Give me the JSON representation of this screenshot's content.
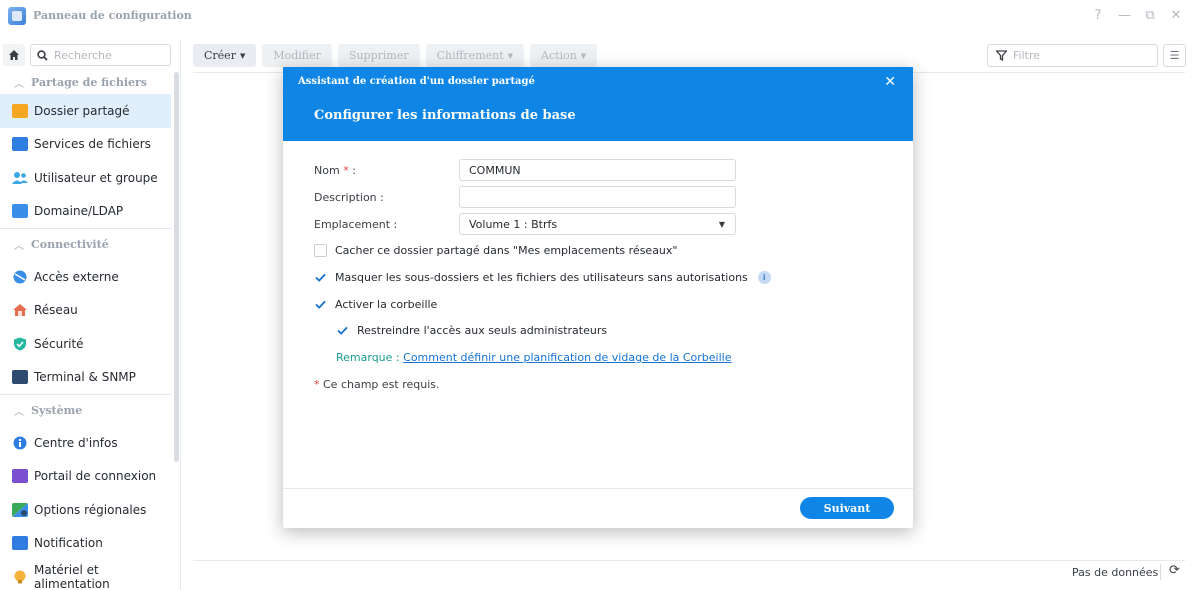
{
  "window": {
    "title": "Panneau de configuration",
    "controls": {
      "help": "?",
      "minimize": "—",
      "maximize": "⧉",
      "close": "✕"
    }
  },
  "sidebar": {
    "search_placeholder": "Recherche",
    "sections": [
      {
        "title": "Partage de fichiers",
        "items": [
          {
            "label": "Dossier partagé",
            "icon": "shared-folder-icon",
            "active": true,
            "color": "#f5a623"
          },
          {
            "label": "Services de fichiers",
            "icon": "file-services-icon",
            "color": "#2f7de1"
          },
          {
            "label": "Utilisateur et groupe",
            "icon": "user-group-icon",
            "color": "#3aa7e6"
          },
          {
            "label": "Domaine/LDAP",
            "icon": "domain-ldap-icon",
            "color": "#3b8ee8"
          }
        ]
      },
      {
        "title": "Connectivité",
        "items": [
          {
            "label": "Accès externe",
            "icon": "external-access-icon",
            "color": "#3b8ee8"
          },
          {
            "label": "Réseau",
            "icon": "network-icon",
            "color": "#e46d4d"
          },
          {
            "label": "Sécurité",
            "icon": "security-shield-icon",
            "color": "#22b8a0"
          },
          {
            "label": "Terminal & SNMP",
            "icon": "terminal-icon",
            "color": "#2c4b6e"
          }
        ]
      },
      {
        "title": "Système",
        "items": [
          {
            "label": "Centre d'infos",
            "icon": "info-center-icon",
            "color": "#2f7de1"
          },
          {
            "label": "Portail de connexion",
            "icon": "login-portal-icon",
            "color": "#7b4fd0"
          },
          {
            "label": "Options régionales",
            "icon": "regional-options-icon",
            "color": "#3aaa5a"
          },
          {
            "label": "Notification",
            "icon": "notification-icon",
            "color": "#2f7de1"
          },
          {
            "label": "Matériel et alimentation",
            "icon": "hardware-power-icon",
            "color": "#f5b13a"
          }
        ]
      }
    ]
  },
  "toolbar": {
    "create": "Créer",
    "modify": "Modifier",
    "delete": "Supprimer",
    "encryption": "Chiffrement",
    "action": "Action",
    "filter_placeholder": "Filtre"
  },
  "footer": {
    "status": "Pas de données"
  },
  "dialog": {
    "wizard_title": "Assistant de création d'un dossier partagé",
    "step_title": "Configurer les informations de base",
    "name_label": "Nom",
    "required_mark": "*",
    "colon": ":",
    "name_value": "COMMUN",
    "description_label": "Description :",
    "description_value": "",
    "location_label": "Emplacement :",
    "location_value": "Volume 1 :  Btrfs",
    "checkbox_hide": {
      "label": "Cacher ce dossier partagé dans \"Mes emplacements réseaux\"",
      "checked": false
    },
    "checkbox_mask": {
      "label": "Masquer les sous-dossiers et les fichiers des utilisateurs sans autorisations",
      "checked": true
    },
    "checkbox_recycle": {
      "label": "Activer la corbeille",
      "checked": true
    },
    "checkbox_admin_only": {
      "label": "Restreindre l'accès aux seuls administrateurs",
      "checked": true
    },
    "note_label": "Remarque :",
    "note_link": "Comment définir une planification de vidage de la Corbeille",
    "required_note": "Ce champ est requis.",
    "next_button": "Suivant",
    "accent_color": "#0f86e6"
  }
}
